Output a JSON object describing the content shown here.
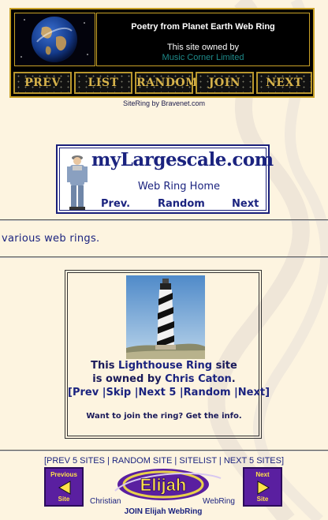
{
  "poetry_ring": {
    "title": "Poetry from Planet Earth Web Ring",
    "owned_by": "This site owned by",
    "owner": "Music Corner Limited",
    "buttons": [
      "PREV",
      "LIST",
      "RANDOM",
      "JOIN",
      "NEXT"
    ],
    "credit": "SiteRing by Bravenet.com"
  },
  "largescale": {
    "logo": "myLargescale.com",
    "home": "Web Ring Home",
    "nav": [
      "Prev.",
      "Random",
      "Next"
    ]
  },
  "various_text": "various web rings.",
  "lighthouse_ring": {
    "line1_prefix": "This ",
    "ring_name": "Lighthouse Ring",
    "line1_suffix": " site",
    "line2_prefix": "is owned by ",
    "owner": "Chris Caton",
    "line2_suffix": ".",
    "nav": [
      "[Prev",
      "|Skip",
      "|Next 5",
      "|Random",
      "|Next]"
    ],
    "join_prefix": "Want to join the ring? Get the ",
    "join_link": "info",
    "join_suffix": "."
  },
  "sitelist": {
    "open": "[",
    "links": [
      "PREV 5 SITES",
      "RANDOM SITE",
      "SITELIST",
      "NEXT 5 SITES"
    ],
    "sep": " | ",
    "close": "]"
  },
  "elijah": {
    "prev_top": "Previous",
    "prev_bottom": "Site",
    "next_top": "Next",
    "next_bottom": "Site",
    "logo": "Elijah",
    "christian": "Christian",
    "webring": "WebRing",
    "join": "JOIN Elijah WebRing"
  },
  "colors": {
    "background": "#fdf4e0",
    "link_blue": "#1b237f",
    "gold": "#c9a227",
    "owner_teal": "#1e8a8a",
    "elijah_purple": "#5a1fa0",
    "elijah_yellow": "#ffe24a"
  },
  "icons": [
    "globe-image",
    "railroad-man-figure",
    "lighthouse-photo",
    "left-arrow-icon",
    "right-arrow-icon",
    "elijah-logo"
  ]
}
